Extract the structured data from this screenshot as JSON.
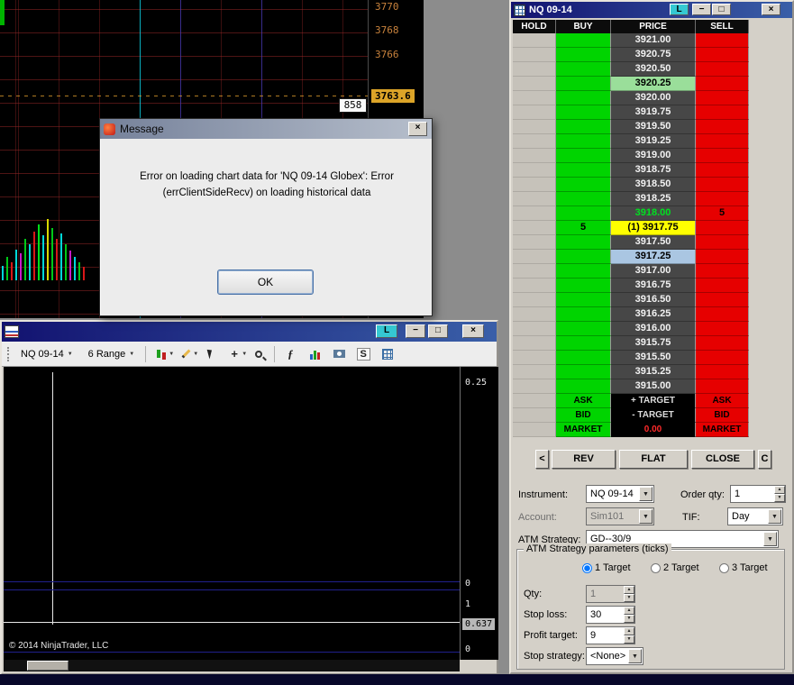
{
  "glyphs": {
    "minimize": "−",
    "maximize": "□",
    "close": "×",
    "dropdown": "▼",
    "up": "▲",
    "down": "▼",
    "crosshair": "+",
    "indicator": "ƒ",
    "link": "L"
  },
  "top_chart": {
    "axis_labels": [
      {
        "text": "3770",
        "y": 1
      },
      {
        "text": "3768",
        "y": 27
      },
      {
        "text": "3766",
        "y": 54
      }
    ],
    "price_badge": "3763.6",
    "count_badge": "858",
    "bars": [
      [
        2,
        16,
        "#00d8d8"
      ],
      [
        7,
        26,
        "#00c818"
      ],
      [
        12,
        20,
        "#d81818"
      ],
      [
        17,
        34,
        "#00d8d8"
      ],
      [
        22,
        30,
        "#c818c8"
      ],
      [
        27,
        46,
        "#00c818"
      ],
      [
        32,
        40,
        "#00d8d8"
      ],
      [
        37,
        54,
        "#d81818"
      ],
      [
        42,
        62,
        "#00e018"
      ],
      [
        47,
        50,
        "#00d8d8"
      ],
      [
        52,
        68,
        "#d8d800"
      ],
      [
        57,
        58,
        "#00c818"
      ],
      [
        62,
        46,
        "#d81818"
      ],
      [
        67,
        52,
        "#00d8d8"
      ],
      [
        72,
        40,
        "#00c818"
      ],
      [
        77,
        33,
        "#c818c8"
      ],
      [
        82,
        26,
        "#00d8d8"
      ],
      [
        87,
        20,
        "#00c818"
      ],
      [
        92,
        15,
        "#d81818"
      ]
    ]
  },
  "dialog": {
    "title": "Message",
    "line1": "Error on loading chart data for 'NQ 09-14 Globex': Error",
    "line2": "(errClientSideRecv) on loading historical data",
    "ok": "OK"
  },
  "chart_window": {
    "instrument": "NQ 09-14",
    "range": "6 Range",
    "s_tool": "S",
    "axis_top": "0.25",
    "axis_zero_a": "0",
    "axis_one": "1",
    "axis_badge": "0.637",
    "axis_zero_b": "0",
    "copyright": "© 2014 NinjaTrader, LLC"
  },
  "dom": {
    "title": "NQ 09-14",
    "headers": [
      "HOLD",
      "BUY",
      "PRICE",
      "SELL"
    ],
    "rows": [
      {
        "buy": "",
        "price": "3921.00",
        "sell": "",
        "cls": ""
      },
      {
        "buy": "",
        "price": "3920.75",
        "sell": "",
        "cls": ""
      },
      {
        "buy": "",
        "price": "3920.50",
        "sell": "",
        "cls": ""
      },
      {
        "buy": "",
        "price": "3920.25",
        "sell": "",
        "cls": "hl-green"
      },
      {
        "buy": "",
        "price": "3920.00",
        "sell": "",
        "cls": ""
      },
      {
        "buy": "",
        "price": "3919.75",
        "sell": "",
        "cls": ""
      },
      {
        "buy": "",
        "price": "3919.50",
        "sell": "",
        "cls": ""
      },
      {
        "buy": "",
        "price": "3919.25",
        "sell": "",
        "cls": ""
      },
      {
        "buy": "",
        "price": "3919.00",
        "sell": "",
        "cls": ""
      },
      {
        "buy": "",
        "price": "3918.75",
        "sell": "",
        "cls": ""
      },
      {
        "buy": "",
        "price": "3918.50",
        "sell": "",
        "cls": ""
      },
      {
        "buy": "",
        "price": "3918.25",
        "sell": "",
        "cls": ""
      },
      {
        "buy": "",
        "price": "3918.00",
        "sell": "5",
        "cls": "last"
      },
      {
        "buy": "5",
        "price": "(1) 3917.75",
        "sell": "",
        "cls": "hl-yellow"
      },
      {
        "buy": "",
        "price": "3917.50",
        "sell": "",
        "cls": ""
      },
      {
        "buy": "",
        "price": "3917.25",
        "sell": "",
        "cls": "hl-blue"
      },
      {
        "buy": "",
        "price": "3917.00",
        "sell": "",
        "cls": ""
      },
      {
        "buy": "",
        "price": "3916.75",
        "sell": "",
        "cls": ""
      },
      {
        "buy": "",
        "price": "3916.50",
        "sell": "",
        "cls": ""
      },
      {
        "buy": "",
        "price": "3916.25",
        "sell": "",
        "cls": ""
      },
      {
        "buy": "",
        "price": "3916.00",
        "sell": "",
        "cls": ""
      },
      {
        "buy": "",
        "price": "3915.75",
        "sell": "",
        "cls": ""
      },
      {
        "buy": "",
        "price": "3915.50",
        "sell": "",
        "cls": ""
      },
      {
        "buy": "",
        "price": "3915.25",
        "sell": "",
        "cls": ""
      },
      {
        "buy": "",
        "price": "3915.00",
        "sell": "",
        "cls": ""
      }
    ],
    "special": [
      {
        "buy": "ASK",
        "price": "+ TARGET",
        "sell": "ASK",
        "market": false
      },
      {
        "buy": "BID",
        "price": "- TARGET",
        "sell": "BID",
        "market": false
      },
      {
        "buy": "MARKET",
        "price": "0.00",
        "sell": "MARKET",
        "market": true
      }
    ],
    "buttons": {
      "prev": "<",
      "rev": "REV",
      "flat": "FLAT",
      "close": "CLOSE",
      "c": "C"
    },
    "form": {
      "instrument_label": "Instrument:",
      "instrument": "NQ 09-14",
      "orderqty_label": "Order qty:",
      "orderqty": "1",
      "account_label": "Account:",
      "account": "Sim101",
      "tif_label": "TIF:",
      "tif": "Day",
      "atm_label": "ATM Strategy:",
      "atm": "GD--30/9",
      "group_title": "ATM Strategy parameters (ticks)",
      "targets": [
        "1 Target",
        "2 Target",
        "3 Target"
      ],
      "qty_label": "Qty:",
      "qty": "1",
      "stoploss_label": "Stop loss:",
      "stoploss": "30",
      "profit_label": "Profit target:",
      "profit": "9",
      "stopstrategy_label": "Stop strategy:",
      "stopstrategy": "<None>"
    }
  }
}
